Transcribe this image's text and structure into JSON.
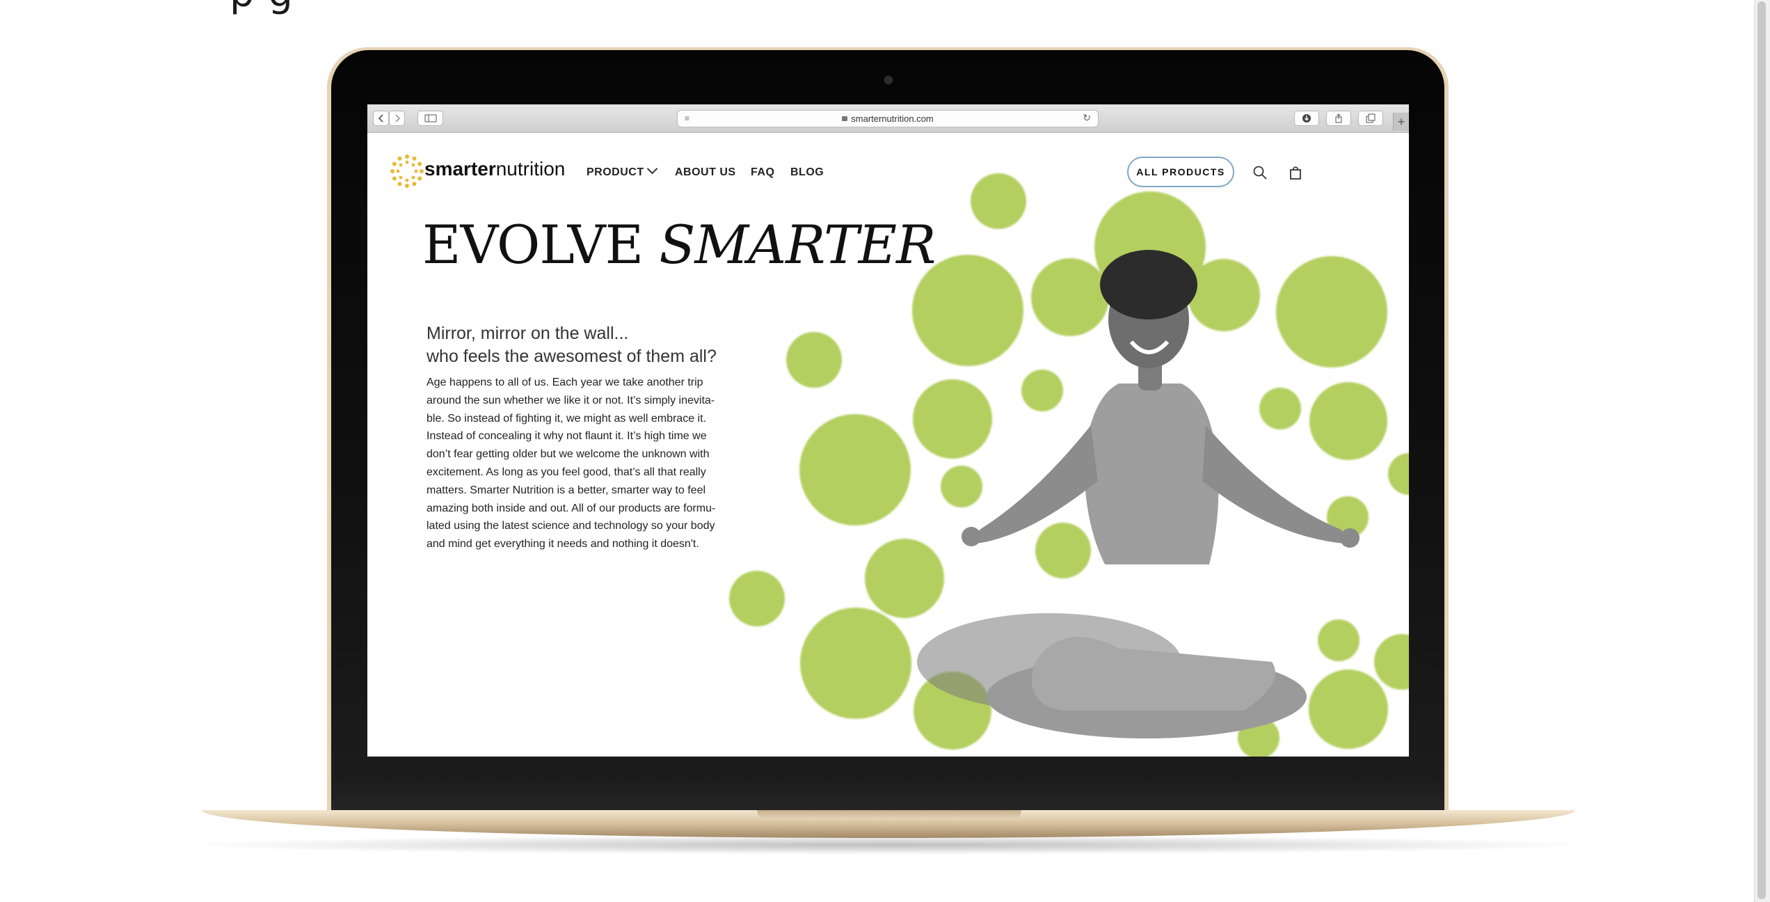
{
  "browser": {
    "url": "smarternutrition.com",
    "new_tab_symbol": "+",
    "icons": [
      "back-icon",
      "forward-icon",
      "sidebar-icon",
      "reader-icon",
      "reload-icon",
      "download-icon",
      "share-icon",
      "tabs-icon"
    ]
  },
  "site": {
    "brand_bold": "smarter",
    "brand_light": "nutrition",
    "nav": {
      "product": "PRODUCT",
      "about": "ABOUT US",
      "faq": "FAQ",
      "blog": "BLOG"
    },
    "all_products": "ALL PRODUCTS",
    "hero_regular": "EVOLVE ",
    "hero_italic": "SMARTER",
    "subtitle_line1": "Mirror, mirror on the wall...",
    "subtitle_line2": "who feels the awesomest of them all?",
    "body_lines": [
      "Age happens to all of us. Each year we take another trip",
      "around the sun whether we like it or not. It’s simply inevita-",
      "ble. So instead of fighting it, we might as well embrace it.",
      "Instead of concealing it why not flaunt it. It’s high time we",
      "don’t fear getting older but we welcome the unknown with",
      "excitement. As long as you feel good, that’s all that really",
      "matters. Smarter Nutrition is a better, smarter way to feel",
      "amazing both inside and out. All of our products are formu-",
      "lated using the latest science and technology so your body",
      "and mind get everything it needs and nothing it doesn't."
    ],
    "colors": {
      "accent_green": "#b3cf5f",
      "logo_yellow": "#e7b93a",
      "button_border": "#7fa6c8"
    }
  }
}
